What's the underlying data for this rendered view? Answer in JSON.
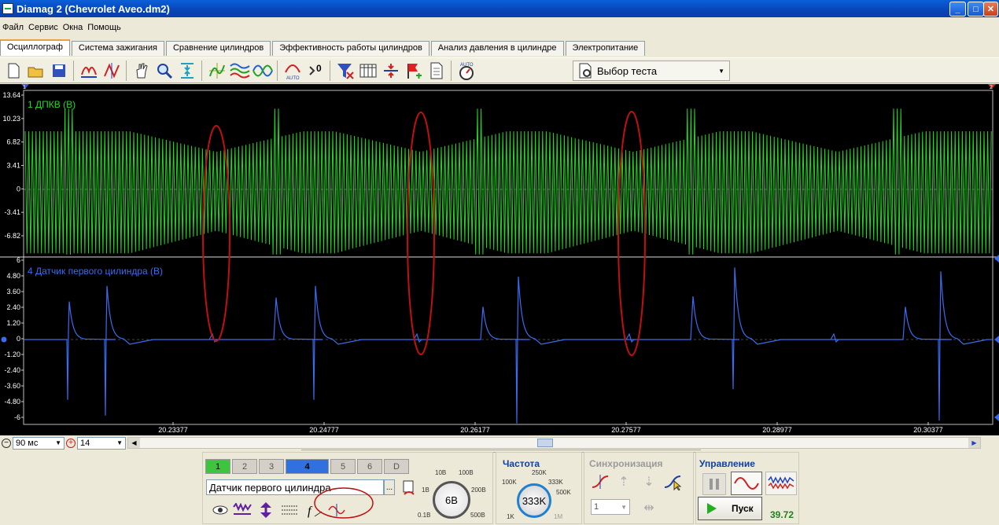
{
  "window": {
    "title": "Diamag 2 (Chevrolet Aveo.dm2)",
    "min": "_",
    "max": "□",
    "close": "✕"
  },
  "menu": [
    "Файл",
    "Сервис",
    "Окна",
    "Помощь"
  ],
  "tabs": [
    "Осциллограф",
    "Система зажигания",
    "Сравнение цилиндров",
    "Эффективность работы цилиндров",
    "Анализ давления в цилиндре",
    "Электропитание"
  ],
  "active_tab": 0,
  "toolbar": {
    "icons": [
      "new-file-icon",
      "open-folder-icon",
      "save-icon",
      "wave-stretch-h-icon",
      "wave-measure-icon",
      "hand-pan-icon",
      "zoom-icon",
      "compress-icon",
      "cursor-cross-icon",
      "multi-wave-icon",
      "overlay-wave-icon",
      "auto-scale-icon",
      "zero-offset-icon",
      "filter-icon",
      "table-icon",
      "divider-icon",
      "marker-add-icon",
      "notes-icon",
      "auto-voltmeter-icon"
    ],
    "auto_label": "AUTO",
    "zero_label": "0",
    "test_select": "Выбор теста"
  },
  "markers": {
    "left": "1",
    "right": "2"
  },
  "channel1": {
    "label": "1 ДПКВ (В)",
    "color": "#22d822",
    "y_ticks": [
      "13.64",
      "10.23",
      "6.82",
      "3.41",
      "0",
      "-3.41",
      "-6.82"
    ]
  },
  "channel4": {
    "label": "4 Датчик первого цилиндра (В)",
    "color": "#3a6cf0",
    "y_ticks": [
      "6",
      "4.80",
      "3.60",
      "2.40",
      "1.20",
      "0",
      "-1.20",
      "-2.40",
      "-3.60",
      "-4.80",
      "-6"
    ]
  },
  "x_ticks": [
    "20.23377",
    "20.24777",
    "20.26177",
    "20.27577",
    "20.28977",
    "20.30377"
  ],
  "timebase": {
    "value": "90 мс"
  },
  "zoom": {
    "value": "14"
  },
  "channels_panel": {
    "buttons": [
      "1",
      "2",
      "3",
      "4",
      "5",
      "6",
      "D"
    ],
    "sensor_name": "Датчик первого цилиндра",
    "more": "...",
    "voltage_knob": "6В",
    "voltage_labels": [
      "10В",
      "100В",
      "1В",
      "200В",
      "0.1В",
      "500В"
    ]
  },
  "frequency_panel": {
    "title": "Частота",
    "knob": "333K",
    "labels": [
      "250K",
      "100K",
      "333K",
      "500K",
      "1K",
      "1M"
    ]
  },
  "sync_panel": {
    "title": "Синхронизация",
    "value": "1"
  },
  "control_panel": {
    "title": "Управление",
    "start": "Пуск",
    "readout": "39.72"
  }
}
